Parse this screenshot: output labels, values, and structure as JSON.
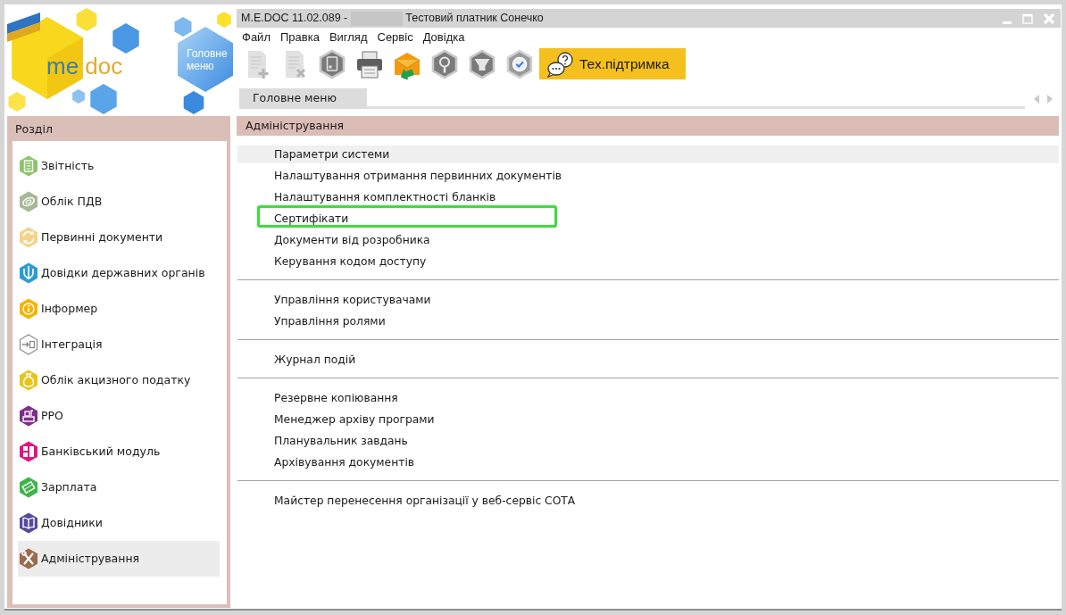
{
  "logo": {
    "parts": [
      "me",
      "doc"
    ]
  },
  "home_button": {
    "label": "Головне меню"
  },
  "window": {
    "title": "M.E.DOC 11.02.089 -",
    "redacted": true,
    "organization": "Тестовий платник Сонечко"
  },
  "menu": [
    "Файл",
    "Правка",
    "Вигляд",
    "Сервіс",
    "Довідка"
  ],
  "toolbar": {
    "buttons": [
      {
        "disabled": true
      },
      {
        "disabled": true
      },
      {
        "disabled": false
      },
      {
        "disabled": false
      },
      {
        "disabled": false
      },
      {
        "disabled": false
      },
      {
        "disabled": false
      },
      {
        "disabled": false
      }
    ],
    "support_button": {
      "label": "Тех.підтримка"
    }
  },
  "tabs": [
    {
      "label": "Головне меню",
      "selected": true
    }
  ],
  "sidebar": {
    "title": "Розділ",
    "items": [
      {
        "label": "Звітність",
        "kind": "filled",
        "color": "#8dc46b",
        "selected": false
      },
      {
        "label": "Облік ПДВ",
        "kind": "filled",
        "color": "#a6b896",
        "selected": false
      },
      {
        "label": "Первинні документи",
        "kind": "filled",
        "color": "#f5d38a",
        "selected": false
      },
      {
        "label": "Довідки державних органів",
        "kind": "filled",
        "color": "#2e9ad6",
        "selected": false
      },
      {
        "label": "Інформер",
        "kind": "filled",
        "color": "#f4b400",
        "selected": false
      },
      {
        "label": "Інтеграція",
        "kind": "outline",
        "color": "#8a8a8a",
        "selected": false
      },
      {
        "label": "Облік акцизного податку",
        "kind": "filled",
        "color": "#e8c51c",
        "selected": false
      },
      {
        "label": "РРО",
        "kind": "filled",
        "color": "#7e2d8f",
        "selected": false
      },
      {
        "label": "Банківський модуль",
        "kind": "filled",
        "color": "#e0157f",
        "selected": false
      },
      {
        "label": "Зарплата",
        "kind": "filled",
        "color": "#3db54a",
        "selected": false
      },
      {
        "label": "Довідники",
        "kind": "filled",
        "color": "#574a9b",
        "selected": false
      },
      {
        "label": "Адміністрування",
        "kind": "filled",
        "color": "#9c6a4f",
        "selected": true
      }
    ]
  },
  "section": {
    "title": "Адміністрування",
    "groups": [
      {
        "items": [
          {
            "label": "Параметри системи",
            "selected": true,
            "highlighted": false
          },
          {
            "label": "Налаштування отримання первинних документів",
            "selected": false,
            "highlighted": false
          },
          {
            "label": "Налаштування комплектності бланків",
            "selected": false,
            "highlighted": false
          },
          {
            "label": "Сертифікати",
            "selected": false,
            "highlighted": true
          },
          {
            "label": "Документи від розробника",
            "selected": false,
            "highlighted": false
          },
          {
            "label": "Керування кодом доступу",
            "selected": false,
            "highlighted": false
          }
        ]
      },
      {
        "items": [
          {
            "label": "Управління користувачами",
            "selected": false,
            "highlighted": false
          },
          {
            "label": "Управління ролями",
            "selected": false,
            "highlighted": false
          }
        ]
      },
      {
        "items": [
          {
            "label": "Журнал подій",
            "selected": false,
            "highlighted": false
          }
        ]
      },
      {
        "items": [
          {
            "label": "Резервне копіювання",
            "selected": false,
            "highlighted": false
          },
          {
            "label": "Менеджер архіву програми",
            "selected": false,
            "highlighted": false
          },
          {
            "label": "Планувальник завдань",
            "selected": false,
            "highlighted": false
          },
          {
            "label": "Архівування документів",
            "selected": false,
            "highlighted": false
          }
        ]
      },
      {
        "items": [
          {
            "label": "Майстер перенесення організації у веб-сервіс СОТА",
            "selected": false,
            "highlighted": false
          }
        ]
      }
    ]
  }
}
